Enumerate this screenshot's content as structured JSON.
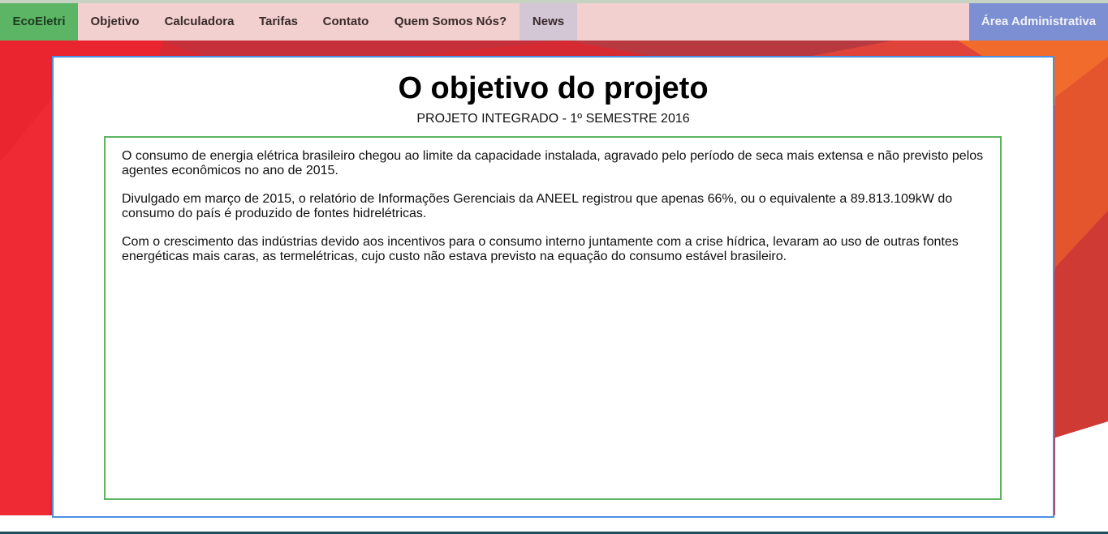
{
  "nav": {
    "brand": "EcoEletri",
    "items": [
      {
        "label": "Objetivo"
      },
      {
        "label": "Calculadora"
      },
      {
        "label": "Tarifas"
      },
      {
        "label": "Contato"
      },
      {
        "label": "Quem Somos Nós?"
      },
      {
        "label": "News"
      }
    ],
    "admin": "Área Administrativa"
  },
  "main": {
    "title": "O objetivo do projeto",
    "subtitle": "PROJETO INTEGRADO - 1º SEMESTRE 2016",
    "paragraphs": [
      "O consumo de energia elétrica brasileiro chegou ao limite da capacidade instalada, agravado pelo período de seca mais extensa e não previsto pelos agentes econômicos no ano de 2015.",
      "Divulgado em março de 2015, o relatório de Informações Gerenciais da ANEEL registrou que apenas 66%, ou o equivalente a 89.813.109kW do consumo do país é produzido de fontes hidrelétricas.",
      "Com o crescimento das indústrias devido aos incentivos para o consumo interno juntamente com a crise hídrica, levaram ao uso de outras fontes energéticas mais caras, as termelétricas, cujo custo não estava previsto na equação do consumo estável brasileiro."
    ]
  },
  "colors": {
    "brand_green": "#5bb565",
    "admin_blue": "#7b8fd2",
    "panel_border": "#4a90e2",
    "content_border": "#5cb45f",
    "background_red": "#e2282f",
    "background_orange": "#ea5a2b"
  }
}
